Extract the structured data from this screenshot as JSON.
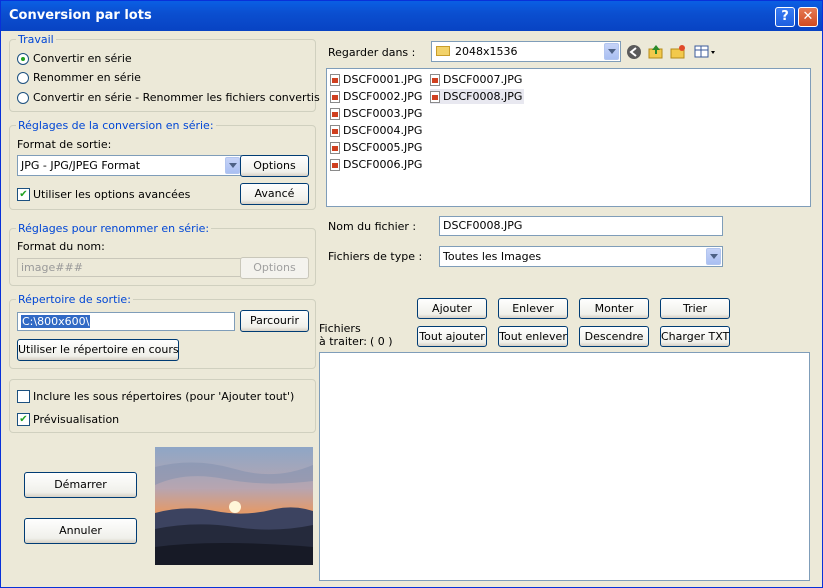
{
  "window": {
    "title": "Conversion par lots",
    "help_label": "?",
    "close_label": "✕"
  },
  "travail": {
    "legend": "Travail",
    "options": [
      "Convertir en série",
      "Renommer en série",
      "Convertir en série - Renommer les fichiers convertis"
    ],
    "selected": 0
  },
  "conversion": {
    "legend": "Réglages de la conversion en série:",
    "format_label": "Format de sortie:",
    "format_value": "JPG - JPG/JPEG Format",
    "options_button": "Options",
    "advanced_check_label": "Utiliser les options avancées",
    "advanced_checked": true,
    "advanced_button": "Avancé"
  },
  "rename": {
    "legend": "Réglages pour renommer en série:",
    "format_label": "Format du nom:",
    "format_value": "image###",
    "options_button": "Options"
  },
  "output": {
    "legend": "Répertoire de sortie:",
    "path_value": "C:\\800x600\\",
    "browse_button": "Parcourir",
    "use_current_button": "Utiliser le répertoire en cours"
  },
  "extra": {
    "include_subdirs_label": "Inclure les sous répertoires (pour 'Ajouter tout')",
    "include_subdirs_checked": false,
    "preview_label": "Prévisualisation",
    "preview_checked": true
  },
  "actions": {
    "start_button": "Démarrer",
    "cancel_button": "Annuler"
  },
  "browser": {
    "look_in_label": "Regarder dans :",
    "look_in_value": "2048x1536",
    "files_col1": [
      "DSCF0001.JPG",
      "DSCF0002.JPG",
      "DSCF0003.JPG",
      "DSCF0004.JPG",
      "DSCF0005.JPG",
      "DSCF0006.JPG"
    ],
    "files_col2": [
      "DSCF0007.JPG",
      "DSCF0008.JPG"
    ],
    "filename_label": "Nom du fichier :",
    "filename_value": "DSCF0008.JPG",
    "filetype_label": "Fichiers de type :",
    "filetype_value": "Toutes les Images"
  },
  "queue": {
    "label": "Fichiers à traiter:",
    "count": "( 0 )",
    "buttons_row1": [
      "Ajouter",
      "Enlever",
      "Monter",
      "Trier"
    ],
    "buttons_row2": [
      "Tout ajouter",
      "Tout enlever",
      "Descendre",
      "Charger TXT"
    ]
  },
  "colors": {
    "titlebar": "#0a5fe4",
    "window_bg": "#ece9d8",
    "group_label": "#0046d5"
  }
}
